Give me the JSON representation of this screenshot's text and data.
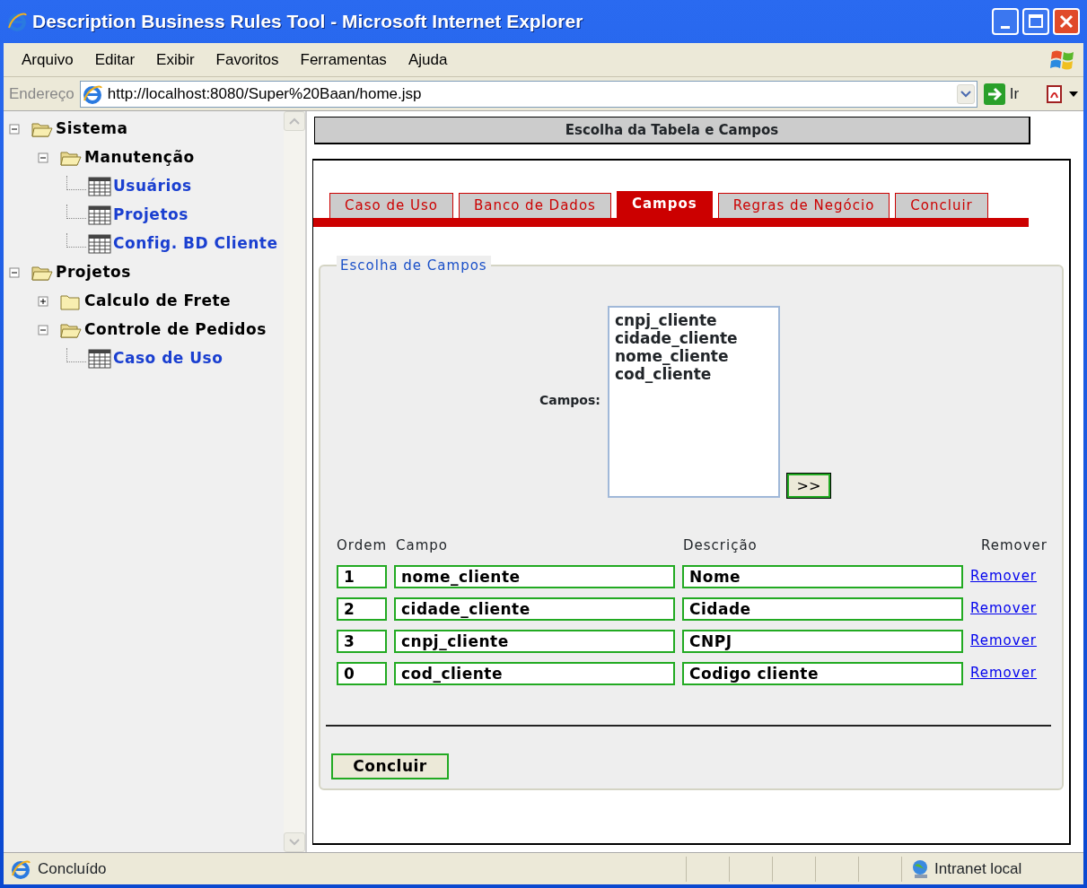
{
  "window": {
    "title": "Description Business Rules Tool - Microsoft Internet Explorer"
  },
  "menu": [
    "Arquivo",
    "Editar",
    "Exibir",
    "Favoritos",
    "Ferramentas",
    "Ajuda"
  ],
  "address_bar": {
    "label": "Endereço",
    "value": "http://localhost:8080/Super%20Baan/home.jsp",
    "go": "Ir"
  },
  "tree": [
    {
      "label": "Sistema",
      "kind": "folder",
      "expanded": true,
      "children": [
        {
          "label": "Manutenção",
          "kind": "folder",
          "expanded": true,
          "children": [
            {
              "label": "Usuários",
              "kind": "table"
            },
            {
              "label": "Projetos",
              "kind": "table"
            },
            {
              "label": "Config. BD Cliente",
              "kind": "table"
            }
          ]
        }
      ]
    },
    {
      "label": "Projetos",
      "kind": "folder",
      "expanded": true,
      "children": [
        {
          "label": "Calculo de Frete",
          "kind": "folder",
          "expanded": false
        },
        {
          "label": "Controle de Pedidos",
          "kind": "folder",
          "expanded": true,
          "children": [
            {
              "label": "Caso de Uso",
              "kind": "table"
            }
          ]
        }
      ]
    }
  ],
  "page_header": "Escolha da Tabela e Campos",
  "tabs": [
    {
      "label": "Caso de Uso",
      "selected": false
    },
    {
      "label": "Banco de Dados",
      "selected": false
    },
    {
      "label": "Campos",
      "selected": true
    },
    {
      "label": "Regras de Negócio",
      "selected": false
    },
    {
      "label": "Concluir",
      "selected": false
    }
  ],
  "fieldset": {
    "legend": "Escolha de Campos",
    "campos_label": "Campos:",
    "options": [
      "cnpj_cliente",
      "cidade_cliente",
      "nome_cliente",
      "cod_cliente"
    ],
    "add_button": ">>",
    "columns": [
      "Ordem",
      "Campo",
      "Descrição",
      "Remover"
    ],
    "rows": [
      {
        "ordem": "1",
        "campo": "nome_cliente",
        "descricao": "Nome",
        "action": "Remover"
      },
      {
        "ordem": "2",
        "campo": "cidade_cliente",
        "descricao": "Cidade",
        "action": "Remover"
      },
      {
        "ordem": "3",
        "campo": "cnpj_cliente",
        "descricao": "CNPJ",
        "action": "Remover"
      },
      {
        "ordem": "0",
        "campo": "cod_cliente",
        "descricao": "Codigo cliente",
        "action": "Remover"
      }
    ],
    "submit": "Concluir"
  },
  "status_bar": {
    "text": "Concluído",
    "zone": "Intranet local"
  }
}
